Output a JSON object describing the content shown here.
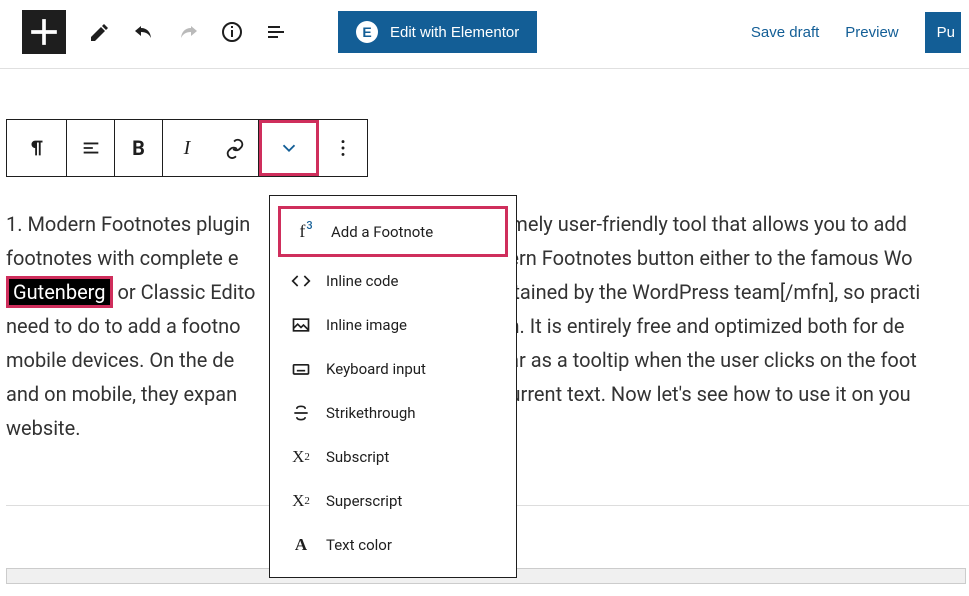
{
  "top": {
    "elementor_label": "Edit with Elementor",
    "save_draft": "Save draft",
    "preview": "Preview",
    "publish": "Pu"
  },
  "dropdown": [
    {
      "label": "Add a Footnote"
    },
    {
      "label": "Inline code"
    },
    {
      "label": "Inline image"
    },
    {
      "label": "Keyboard input"
    },
    {
      "label": "Strikethrough"
    },
    {
      "label": "Subscript"
    },
    {
      "label": "Superscript"
    },
    {
      "label": "Text color"
    }
  ],
  "body": {
    "p1a": "1. Modern Footnotes plugin",
    "p1b": "mely user-friendly tool that allows you to add ",
    "p2a": "footnotes with complete e",
    "p2b": "ern Footnotes button either to the famous Wo",
    "sel": "Gutenberg",
    "p3a": " or Classic Edito",
    "p3b": "tained by the WordPress team[/mfn], so practi",
    "p4a": "need to do to add a footno",
    "p4b": "n. It is entirely free and optimized both for de",
    "p5a": "mobile devices. On the de",
    "p5b": "ar as a tooltip when the user clicks on the foot",
    "p6a": "and on mobile, they expan",
    "p6b": "current text. Now let's see how to use it on you",
    "p7": "website."
  }
}
